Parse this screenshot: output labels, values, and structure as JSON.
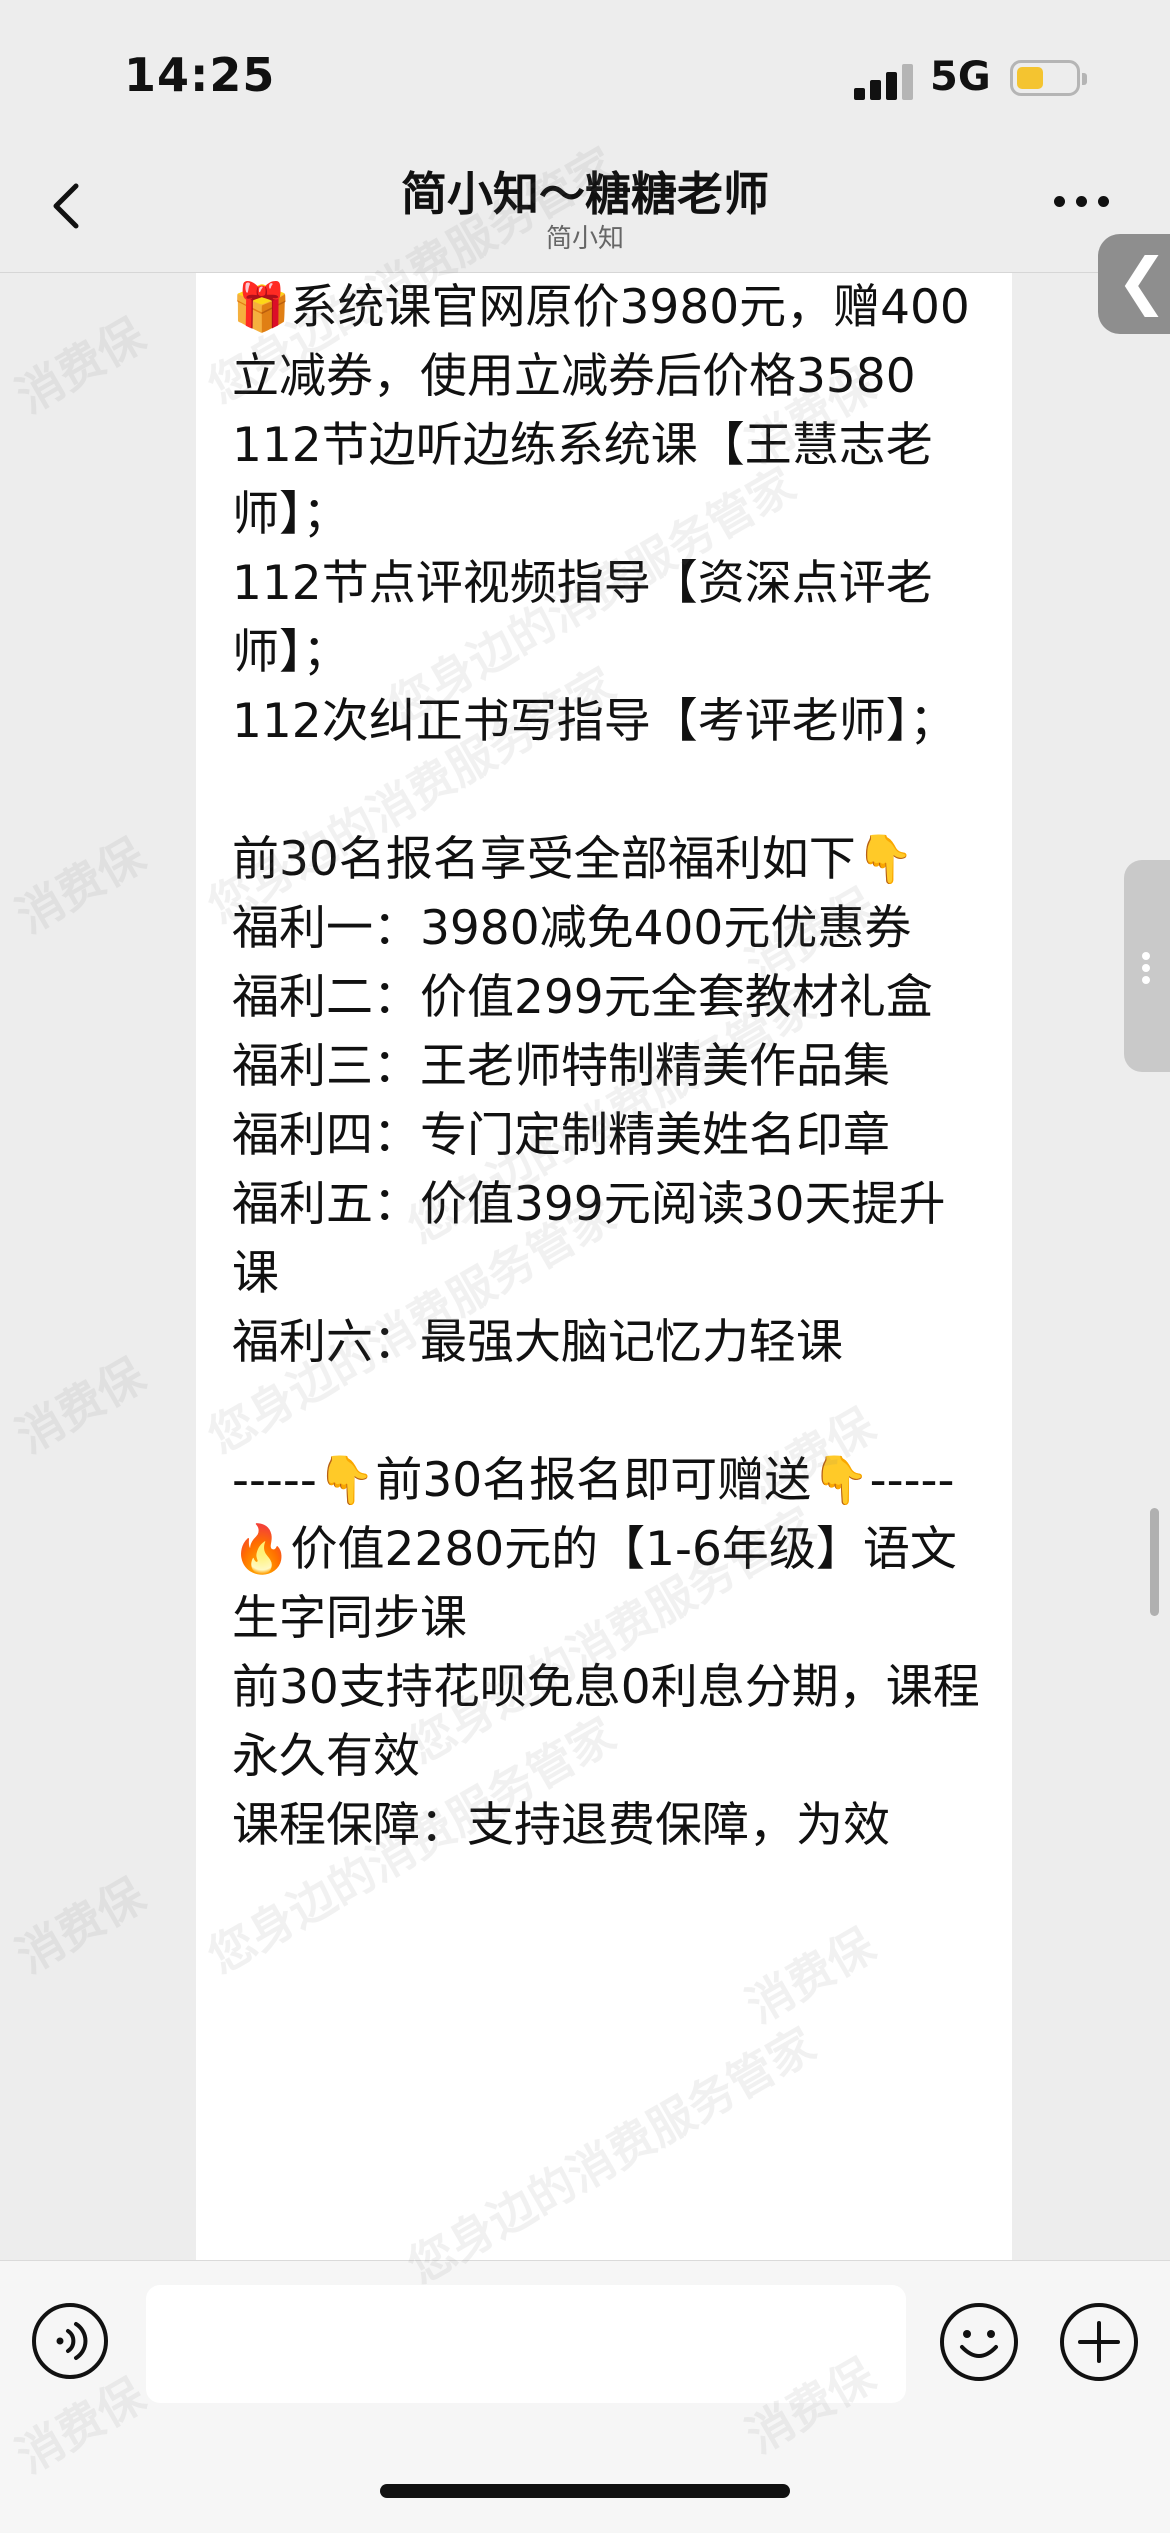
{
  "status_bar": {
    "time": "14:25",
    "network": "5G"
  },
  "nav": {
    "title": "简小知～糖糖老师",
    "subtitle": "简小知"
  },
  "side_tab": {
    "glyph": "❮"
  },
  "message": {
    "text": "🎁系统课官网原价3980元，赠400立减券，使用立减券后价格3580\n112节边听边练系统课【王慧志老师】；\n112节点评视频指导【资深点评老师】；\n112次纠正书写指导【考评老师】；\n\n前30名报名享受全部福利如下👇\n福利一：3980减免400元优惠券\n福利二：价值299元全套教材礼盒\n福利三：王老师特制精美作品集\n福利四：专门定制精美姓名印章\n福利五：价值399元阅读30天提升课\n福利六：最强大脑记忆力轻课\n\n-----👇前30名报名即可赠送👇-----\n🔥价值2280元的【1-6年级】语文生字同步课\n前30支持花呗免息0利息分期，课程永久有效\n课程保障：支持退费保障，为效"
  },
  "watermark": {
    "lines": [
      "消费保",
      "您身边的消费服务管家"
    ]
  },
  "colors": {
    "background": "#ededed",
    "bubble": "#ffffff",
    "battery": "#f4c430",
    "side_tab": "#8e8e8e"
  },
  "icons": [
    "back-chevron-icon",
    "more-dots-icon",
    "voice-icon",
    "emoji-icon",
    "plus-icon",
    "signal-icon",
    "battery-icon"
  ]
}
